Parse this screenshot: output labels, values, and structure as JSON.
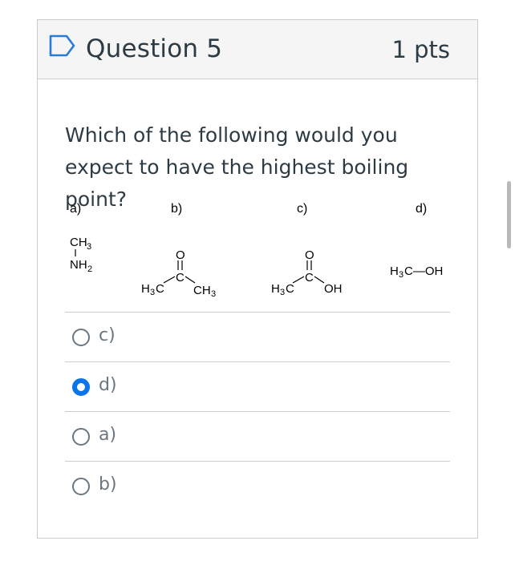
{
  "question": {
    "title": "Question 5",
    "points": "1 pts",
    "text": "Which of the following would you expect to have the highest boiling point?"
  },
  "structures": {
    "a": {
      "label": "a)",
      "top": "CH",
      "top_sub": "3",
      "bottom": "NH",
      "bottom_sub": "2"
    },
    "b": {
      "label": "b)",
      "o": "O",
      "c": "C",
      "left": "H",
      "left_sub": "3",
      "left_c": "C",
      "right": "CH",
      "right_sub": "3"
    },
    "c": {
      "label": "c)",
      "o": "O",
      "c": "C",
      "left": "H",
      "left_sub": "3",
      "left_c": "C",
      "right": "OH"
    },
    "d": {
      "label": "d)",
      "h": "H",
      "h_sub": "3",
      "rest": "C—OH"
    }
  },
  "answers": [
    {
      "label": "c)",
      "selected": false
    },
    {
      "label": "d)",
      "selected": true
    },
    {
      "label": "a)",
      "selected": false
    },
    {
      "label": "b)",
      "selected": false
    }
  ],
  "colors": {
    "accent": "#0a74e8",
    "header_bg": "#f5f5f5",
    "border": "#c7cdd1",
    "text": "#2d3b45"
  },
  "icons": {
    "flag": "bookmark-flag-icon"
  }
}
